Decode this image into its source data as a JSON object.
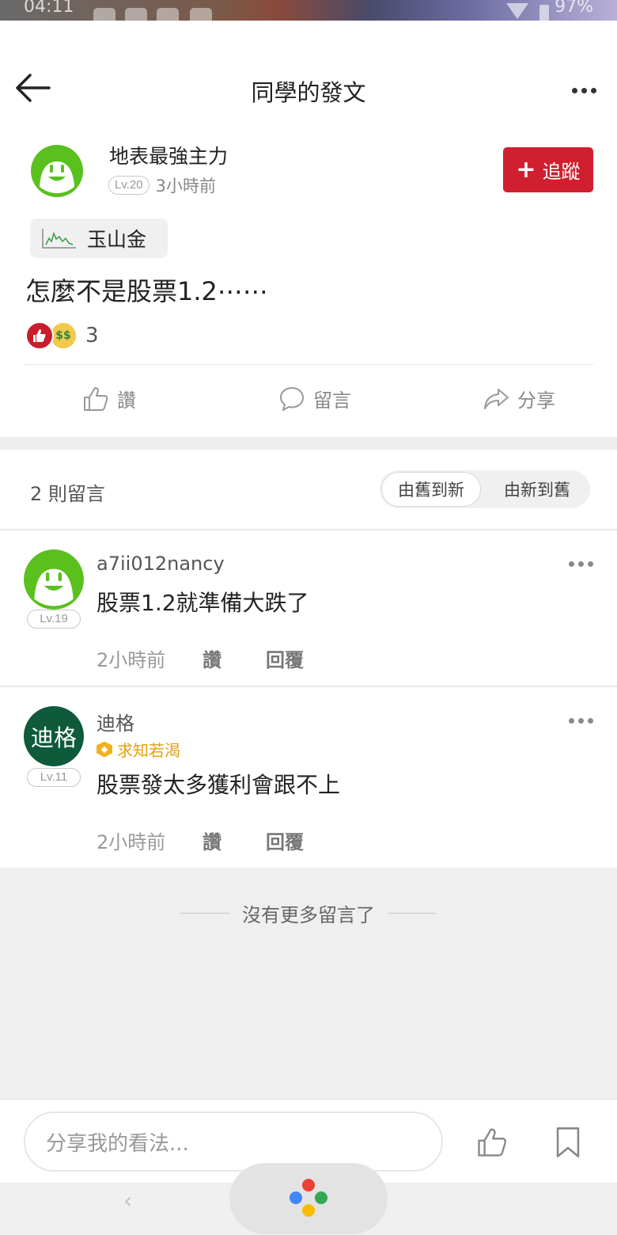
{
  "status_bar": {
    "time": "04:11",
    "battery": "97%"
  },
  "header": {
    "title": "同學的發文"
  },
  "post": {
    "author": {
      "name": "地表最強主力",
      "level": "Lv.20",
      "time": "3小時前"
    },
    "follow_label": "追蹤",
    "stock_tag": "玉山金",
    "content": "怎麼不是股票1.2⋯⋯",
    "reaction_count": "3"
  },
  "actions": {
    "like": "讚",
    "comment": "留言",
    "share": "分享"
  },
  "comments_section": {
    "count_label": "2 則留言",
    "sort_options": [
      "由舊到新",
      "由新到舊"
    ],
    "active_sort": "由舊到新"
  },
  "comments": [
    {
      "username": "a7ii012nancy",
      "level": "Lv.19",
      "text": "股票1.2就準備大跌了",
      "time": "2小時前",
      "like_label": "讚",
      "reply_label": "回覆"
    },
    {
      "username": "迪格",
      "avatar_text": "迪格",
      "level": "Lv.11",
      "title_badge": "求知若渴",
      "text": "股票發太多獲利會跟不上",
      "time": "2小時前",
      "like_label": "讚",
      "reply_label": "回覆"
    }
  ],
  "no_more_label": "沒有更多留言了",
  "bottom_bar": {
    "input_placeholder": "分享我的看法..."
  },
  "colors": {
    "accent_red": "#d01f2e",
    "badge_gold": "#e5a00d",
    "avatar_green": "#5ac01e",
    "avatar_dark_green": "#0e5a3a"
  }
}
